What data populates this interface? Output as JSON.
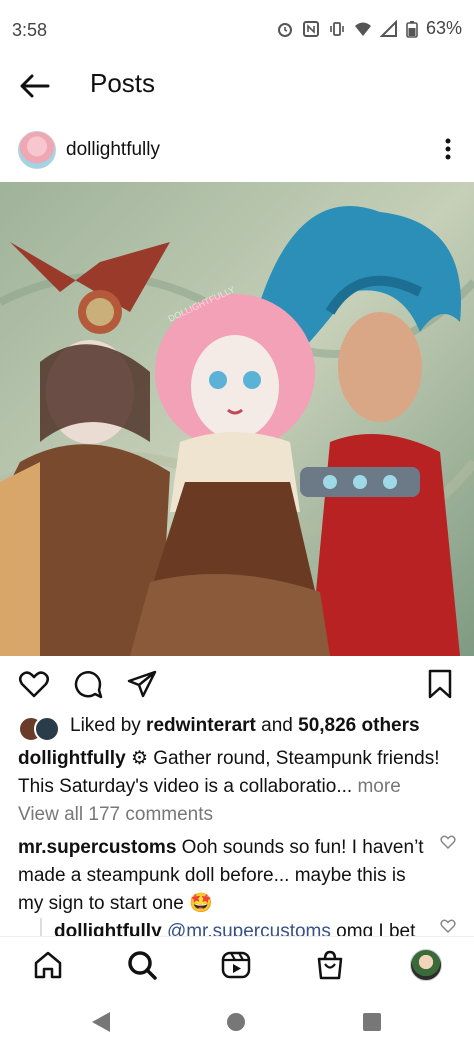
{
  "status_bar": {
    "time": "3:58",
    "battery": "63%",
    "icons": [
      "alarm-icon",
      "nfc-icon",
      "vibrate-icon",
      "wifi-icon",
      "signal-icon",
      "battery-icon"
    ]
  },
  "header": {
    "title": "Posts",
    "back_icon": "arrow-left-icon"
  },
  "post": {
    "username": "dollightfully",
    "photo_icon": "doll-photo",
    "liked_prefix": "Liked by ",
    "liked_user": "redwinterart",
    "liked_middle": " and ",
    "liked_count": "50,826 others",
    "caption_user": "dollightfully",
    "caption_emoji": "⚙",
    "caption_text": " Gather round, Steampunk friends! This Saturday's video is a collaboratio...",
    "more_label": " more",
    "view_all": "View all 177 comments",
    "comment_user": "mr.supercustoms",
    "comment_text": " Ooh sounds so fun! I haven’t made a steampunk doll before... maybe this is my sign to start one ",
    "comment_emoji": "🤩",
    "reply_user": "dollightfully",
    "reply_mention": "@mr.supercustoms",
    "reply_text": " omg I bet"
  },
  "colors": {
    "accent_link": "#385185",
    "muted": "#777777",
    "text": "#111111"
  }
}
